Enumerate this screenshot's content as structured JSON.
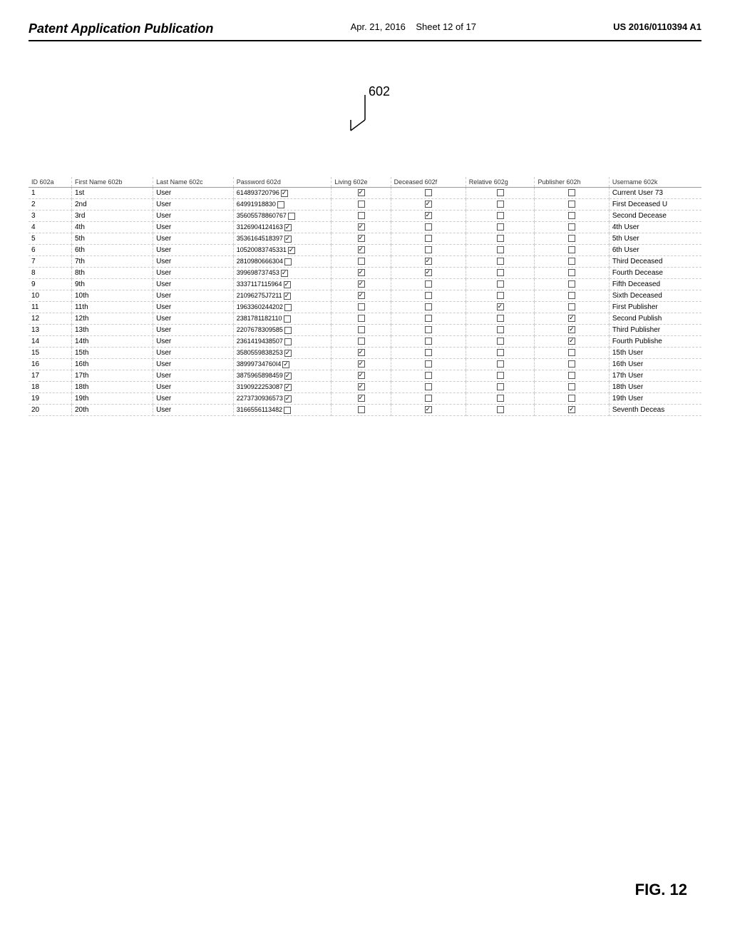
{
  "header": {
    "left_title": "Patent Application Publication",
    "center_date": "Apr. 21, 2016",
    "center_sheet": "Sheet 12 of 17",
    "right_patent": "US 2016/0110394 A1"
  },
  "diagram": {
    "label": "602",
    "fig": "FIG. 12"
  },
  "table": {
    "columns": [
      "ID 602a",
      "First Name 602b",
      "Last Name 602c",
      "Password 602d",
      "Living 602e",
      "Deceased 602f",
      "Relative 602g",
      "Publisher 602h",
      "Username 602k"
    ],
    "rows": [
      {
        "id": "1",
        "first": "1st",
        "last": "User",
        "password": "614893720796",
        "living": true,
        "deceased": false,
        "relative": false,
        "publisher": false,
        "username": "Current User 73"
      },
      {
        "id": "2",
        "first": "2nd",
        "last": "User",
        "password": "64991918830",
        "living": false,
        "deceased": true,
        "relative": false,
        "publisher": false,
        "username": "First Deceased U"
      },
      {
        "id": "3",
        "first": "3rd",
        "last": "User",
        "password": "35605578860767",
        "living": false,
        "deceased": true,
        "relative": false,
        "publisher": false,
        "username": "Second Decease"
      },
      {
        "id": "4",
        "first": "4th",
        "last": "User",
        "password": "3126904124163",
        "living": true,
        "deceased": false,
        "relative": false,
        "publisher": false,
        "username": "4th User"
      },
      {
        "id": "5",
        "first": "5th",
        "last": "User",
        "password": "3536164518397",
        "living": true,
        "deceased": false,
        "relative": false,
        "publisher": false,
        "username": "5th User"
      },
      {
        "id": "6",
        "first": "6th",
        "last": "User",
        "password": "10520083745331",
        "living": true,
        "deceased": false,
        "relative": false,
        "publisher": false,
        "username": "6th User"
      },
      {
        "id": "7",
        "first": "7th",
        "last": "User",
        "password": "2810980666304",
        "living": false,
        "deceased": true,
        "relative": false,
        "publisher": false,
        "username": "Third Deceased"
      },
      {
        "id": "8",
        "first": "8th",
        "last": "User",
        "password": "399698737453",
        "living": true,
        "deceased": true,
        "relative": false,
        "publisher": false,
        "username": "Fourth Decease"
      },
      {
        "id": "9",
        "first": "9th",
        "last": "User",
        "password": "3337117115964",
        "living": true,
        "deceased": false,
        "relative": false,
        "publisher": false,
        "username": "Fifth Deceased"
      },
      {
        "id": "10",
        "first": "10th",
        "last": "User",
        "password": "21096275J7211",
        "living": true,
        "deceased": false,
        "relative": false,
        "publisher": false,
        "username": "Sixth Deceased"
      },
      {
        "id": "11",
        "first": "11th",
        "last": "User",
        "password": "1963360244202",
        "living": false,
        "deceased": false,
        "relative": true,
        "publisher": false,
        "username": "First Publisher"
      },
      {
        "id": "12",
        "first": "12th",
        "last": "User",
        "password": "2381781182110",
        "living": false,
        "deceased": false,
        "relative": false,
        "publisher": true,
        "username": "Second Publish"
      },
      {
        "id": "13",
        "first": "13th",
        "last": "User",
        "password": "2207678309585",
        "living": false,
        "deceased": false,
        "relative": false,
        "publisher": true,
        "username": "Third Publisher"
      },
      {
        "id": "14",
        "first": "14th",
        "last": "User",
        "password": "2361419438507",
        "living": false,
        "deceased": false,
        "relative": false,
        "publisher": true,
        "username": "Fourth Publishe"
      },
      {
        "id": "15",
        "first": "15th",
        "last": "User",
        "password": "3580559838253",
        "living": true,
        "deceased": false,
        "relative": false,
        "publisher": false,
        "username": "15th User"
      },
      {
        "id": "16",
        "first": "16th",
        "last": "User",
        "password": "38999734760I4",
        "living": true,
        "deceased": false,
        "relative": false,
        "publisher": false,
        "username": "16th User"
      },
      {
        "id": "17",
        "first": "17th",
        "last": "User",
        "password": "3875965898459",
        "living": true,
        "deceased": false,
        "relative": false,
        "publisher": false,
        "username": "17th User"
      },
      {
        "id": "18",
        "first": "18th",
        "last": "User",
        "password": "3190922253087",
        "living": true,
        "deceased": false,
        "relative": false,
        "publisher": false,
        "username": "18th User"
      },
      {
        "id": "19",
        "first": "19th",
        "last": "User",
        "password": "2273730936573",
        "living": true,
        "deceased": false,
        "relative": false,
        "publisher": false,
        "username": "19th User"
      },
      {
        "id": "20",
        "first": "20th",
        "last": "User",
        "password": "3166556113482",
        "living": false,
        "deceased": true,
        "relative": false,
        "publisher": true,
        "username": "Seventh Deceas"
      }
    ]
  }
}
